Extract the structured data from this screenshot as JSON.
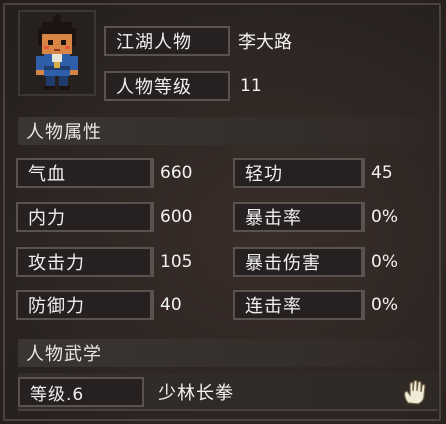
{
  "character": {
    "name_label": "江湖人物",
    "name_value": "李大路",
    "level_label": "人物等级",
    "level_value": "11"
  },
  "sections": {
    "attributes": "人物属性",
    "martial": "人物武学"
  },
  "stats": {
    "hp_label": "气血",
    "hp_value": "660",
    "qinggong_label": "轻功",
    "qinggong_value": "45",
    "neili_label": "内力",
    "neili_value": "600",
    "crit_label": "暴击率",
    "crit_value": "0%",
    "attack_label": "攻击力",
    "attack_value": "105",
    "critdmg_label": "暴击伤害",
    "critdmg_value": "0%",
    "defense_label": "防御力",
    "defense_value": "40",
    "combo_label": "连击率",
    "combo_value": "0%"
  },
  "skill": {
    "level_label": "等级.6",
    "name": "少林长拳",
    "icon": "palm-icon"
  }
}
